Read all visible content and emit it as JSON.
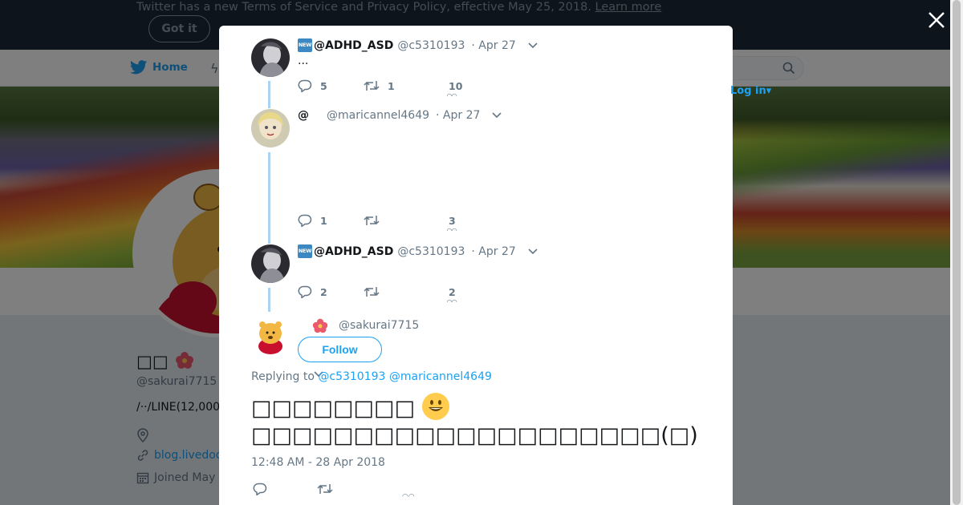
{
  "banner": {
    "text": "Twitter has a new Terms of Service and Privacy Policy, effective May 25, 2018.",
    "link": "Learn more",
    "button": "Got it"
  },
  "nav": {
    "home": "Home",
    "login": "Log in"
  },
  "profile": {
    "name": "□□",
    "handle": "@sakurai7715",
    "bio": "/··/LINE(12,000",
    "link": "blog.livedoo",
    "joined": "Joined May"
  },
  "thread": [
    {
      "name": "@ADHD_ASD",
      "badge": "NEW",
      "handle": "@c5310193",
      "time": "· Apr 27",
      "body": "...",
      "replies": "5",
      "retweets": "1",
      "likes": "10"
    },
    {
      "name": "@",
      "badge": "",
      "handle": "@maricannel4649",
      "time": "· Apr 27",
      "body": "",
      "replies": "1",
      "retweets": "",
      "likes": "3"
    },
    {
      "name": "@ADHD_ASD",
      "badge": "NEW",
      "handle": "@c5310193",
      "time": "· Apr 27",
      "body": "",
      "replies": "2",
      "retweets": "",
      "likes": "2"
    }
  ],
  "main_tweet": {
    "handle": "@sakurai7715",
    "follow": "Follow",
    "replying_label": "Replying to",
    "replying_to": "@c5310193 @maricannel4649",
    "line1": "□□□□□□□□",
    "line2": "□□□□□□□□□□□□□□□□□□□□(□)",
    "date": "12:48 AM - 28 Apr 2018"
  },
  "icons": [
    "close-icon",
    "bird-icon",
    "search-icon",
    "reply-icon",
    "retweet-icon",
    "heart-icon",
    "caret-icon",
    "location-icon",
    "link-icon",
    "calendar-icon",
    "hibiscus-icon",
    "smiley-icon"
  ],
  "colors": {
    "accent": "#1da1f2",
    "thread": "#a8d3f4",
    "banner": "#1c2938"
  }
}
